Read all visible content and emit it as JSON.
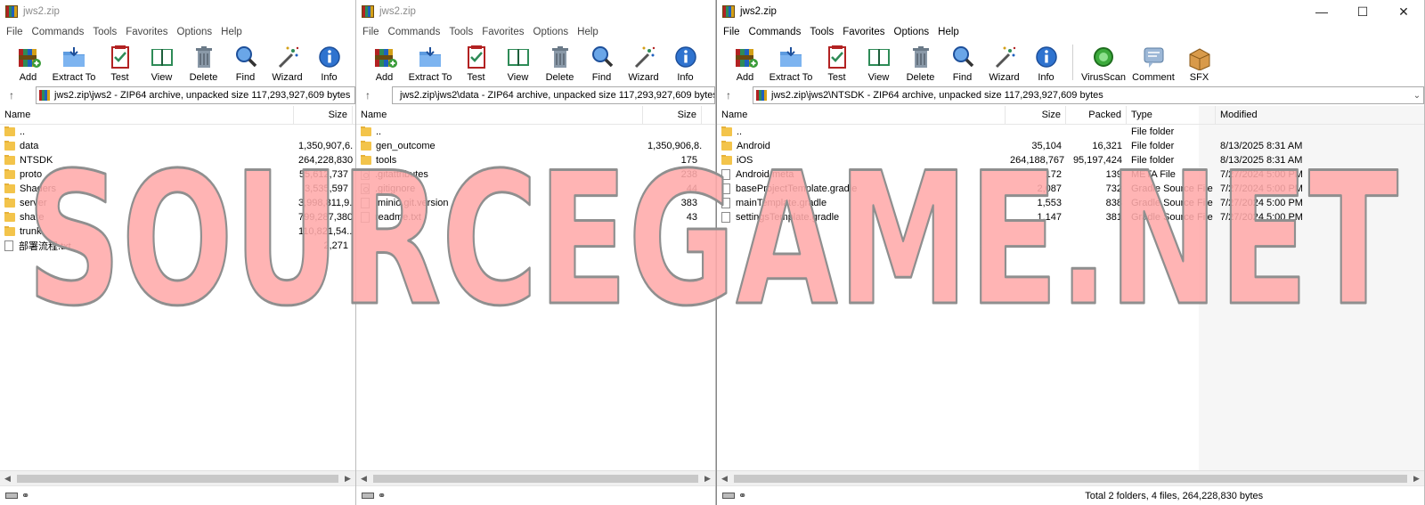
{
  "toolbar_labels": {
    "add": "Add",
    "extract": "Extract To",
    "test": "Test",
    "view": "View",
    "delete": "Delete",
    "find": "Find",
    "wizard": "Wizard",
    "info": "Info",
    "virusscan": "VirusScan",
    "comment": "Comment",
    "sfx": "SFX"
  },
  "menu": [
    "File",
    "Commands",
    "Tools",
    "Favorites",
    "Options",
    "Help"
  ],
  "watermark": "SOURCEGAME.NET",
  "windows": [
    {
      "title": "jws2.zip",
      "address": "jws2.zip\\jws2 - ZIP64 archive, unpacked size 117,293,927,609 bytes",
      "columns": {
        "name": "Name",
        "size": "Size"
      },
      "files": [
        {
          "name": "..",
          "size": "",
          "icon": "folder-icon"
        },
        {
          "name": "data",
          "size": "1,350,907,6...",
          "icon": "folder-icon"
        },
        {
          "name": "NTSDK",
          "size": "264,228,830",
          "icon": "folder-icon"
        },
        {
          "name": "proto",
          "size": "55,612,737",
          "icon": "folder-icon"
        },
        {
          "name": "Shaders",
          "size": "3,535,597",
          "icon": "folder-icon"
        },
        {
          "name": "server",
          "size": "3,998,811,9...",
          "icon": "folder-icon"
        },
        {
          "name": "share",
          "size": "799,287,380",
          "icon": "folder-icon"
        },
        {
          "name": "trunk",
          "size": "110,821,54...",
          "icon": "folder-icon"
        },
        {
          "name": "部署流程.txt",
          "size": "2,271",
          "icon": "file-icon"
        }
      ]
    },
    {
      "title": "jws2.zip",
      "address": "jws2.zip\\jws2\\data - ZIP64 archive, unpacked size 117,293,927,609 bytes",
      "columns": {
        "name": "Name",
        "size": "Size"
      },
      "files": [
        {
          "name": "..",
          "size": "",
          "icon": "folder-icon"
        },
        {
          "name": "gen_outcome",
          "size": "1,350,906,8...",
          "icon": "folder-icon"
        },
        {
          "name": "tools",
          "size": "175",
          "icon": "folder-icon"
        },
        {
          "name": ".gitattributes",
          "size": "238",
          "icon": "config-file-icon"
        },
        {
          "name": ".gitignore",
          "size": "44",
          "icon": "config-file-icon"
        },
        {
          "name": ".minio.git.version",
          "size": "383",
          "icon": "file-icon"
        },
        {
          "name": "readme.txt",
          "size": "43",
          "icon": "file-icon"
        }
      ]
    },
    {
      "title": "jws2.zip",
      "address": "jws2.zip\\jws2\\NTSDK - ZIP64 archive, unpacked size 117,293,927,609 bytes",
      "columns": {
        "name": "Name",
        "size": "Size",
        "packed": "Packed",
        "type": "Type",
        "modified": "Modified"
      },
      "files": [
        {
          "name": "..",
          "size": "",
          "packed": "",
          "type": "File folder",
          "modified": "",
          "icon": "folder-icon"
        },
        {
          "name": "Android",
          "size": "35,104",
          "packed": "16,321",
          "type": "File folder",
          "modified": "8/13/2025 8:31 AM",
          "icon": "folder-icon"
        },
        {
          "name": "iOS",
          "size": "264,188,767",
          "packed": "95,197,424",
          "type": "File folder",
          "modified": "8/13/2025 8:31 AM",
          "icon": "folder-icon"
        },
        {
          "name": "Android.meta",
          "size": "172",
          "packed": "139",
          "type": "META File",
          "modified": "7/27/2024 5:00 PM",
          "icon": "file-icon"
        },
        {
          "name": "baseProjectTemplate.gradle",
          "size": "2,087",
          "packed": "732",
          "type": "Gradle Source File",
          "modified": "7/27/2024 5:00 PM",
          "icon": "file-icon"
        },
        {
          "name": "mainTemplate.gradle",
          "size": "1,553",
          "packed": "838",
          "type": "Gradle Source File",
          "modified": "7/27/2024 5:00 PM",
          "icon": "file-icon"
        },
        {
          "name": "settingsTemplate.gradle",
          "size": "1,147",
          "packed": "381",
          "type": "Gradle Source File",
          "modified": "7/27/2024 5:00 PM",
          "icon": "file-icon"
        }
      ],
      "status": "Total 2 folders, 4 files, 264,228,830 bytes"
    }
  ]
}
